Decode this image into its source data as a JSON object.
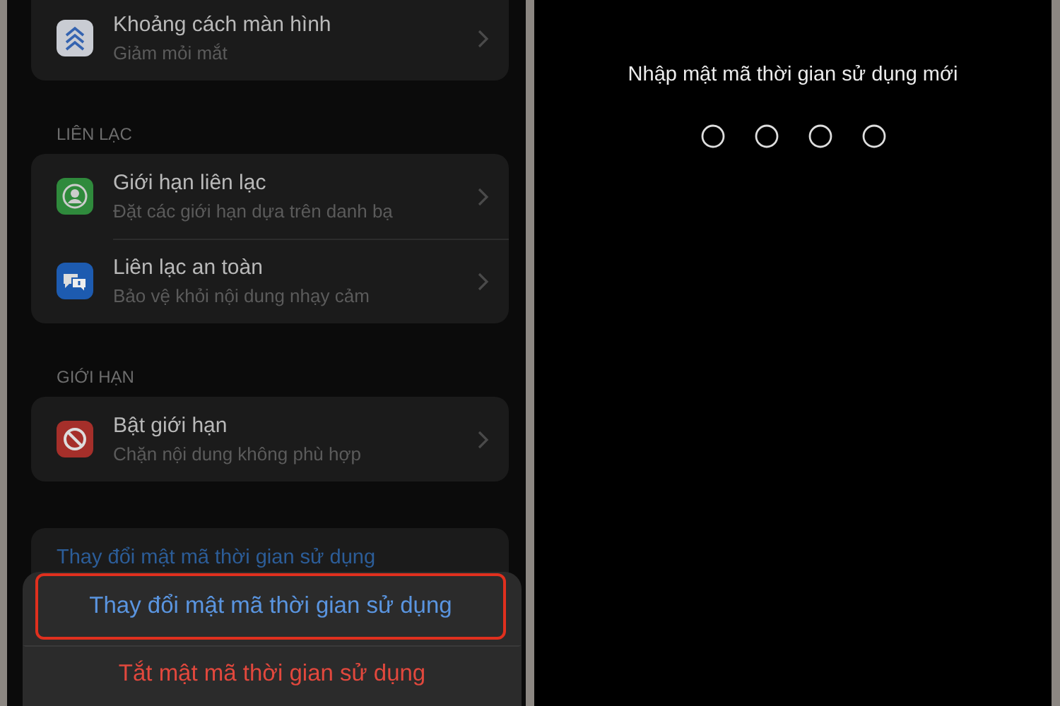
{
  "left_screen": {
    "sections": [
      {
        "rows": [
          {
            "kind": "chevrons",
            "title": "Khoảng cách màn hình",
            "subtitle": "Giảm mỏi mắt"
          }
        ]
      },
      {
        "header": "LIÊN LẠC",
        "rows": [
          {
            "kind": "contact",
            "title": "Giới hạn liên lạc",
            "subtitle": "Đặt các giới hạn dựa trên danh bạ"
          },
          {
            "kind": "bubbles",
            "title": "Liên lạc an toàn",
            "subtitle": "Bảo vệ khỏi nội dung nhạy cảm"
          }
        ]
      },
      {
        "header": "GIỚI HẠN",
        "rows": [
          {
            "kind": "block",
            "title": "Bật giới hạn",
            "subtitle": "Chặn nội dung không phù hợp"
          }
        ]
      }
    ],
    "link": "Thay đổi mật mã thời gian sử dụng",
    "action_sheet": [
      {
        "label": "Thay đổi mật mã thời gian sử dụng",
        "kind": "default",
        "outlined": true
      },
      {
        "label": "Tắt mật mã thời gian sử dụng",
        "kind": "destructive",
        "outlined": false
      }
    ]
  },
  "right_screen": {
    "prompt": "Nhập mật mã thời gian sử dụng mới",
    "digits": [
      {
        "filled": false
      },
      {
        "filled": false
      },
      {
        "filled": false
      },
      {
        "filled": false
      }
    ]
  }
}
